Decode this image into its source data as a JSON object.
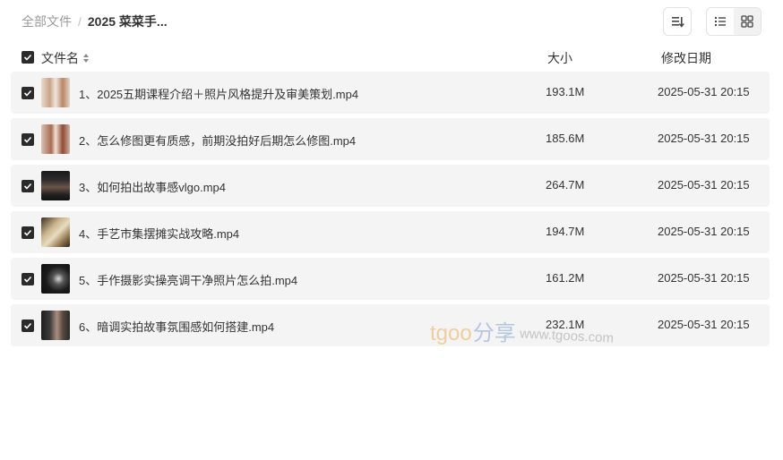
{
  "breadcrumb": {
    "root": "全部文件",
    "separator": "/",
    "current": "2025 菜菜手..."
  },
  "toolbar": {
    "sort_icon": "sort-lines-icon",
    "list_icon": "list-view-icon",
    "grid_icon": "grid-view-icon"
  },
  "header": {
    "name": "文件名",
    "size": "大小",
    "date": "修改日期"
  },
  "files": [
    {
      "name": "1、2025五期课程介绍＋照片风格提升及审美策划.mp4",
      "size": "193.1M",
      "date": "2025-05-31 20:15"
    },
    {
      "name": "2、怎么修图更有质感，前期没拍好后期怎么修图.mp4",
      "size": "185.6M",
      "date": "2025-05-31 20:15"
    },
    {
      "name": "3、如何拍出故事感vlgo.mp4",
      "size": "264.7M",
      "date": "2025-05-31 20:15"
    },
    {
      "name": "4、手艺市集摆摊实战攻略.mp4",
      "size": "194.7M",
      "date": "2025-05-31 20:15"
    },
    {
      "name": "5、手作摄影实操亮调干净照片怎么拍.mp4",
      "size": "161.2M",
      "date": "2025-05-31 20:15"
    },
    {
      "name": "6、暗调实拍故事氛围感如何搭建.mp4",
      "size": "232.1M",
      "date": "2025-05-31 20:15"
    }
  ],
  "watermark": {
    "brand": "tgoo",
    "cn": "分享",
    "url": "www.tgoos.com"
  }
}
